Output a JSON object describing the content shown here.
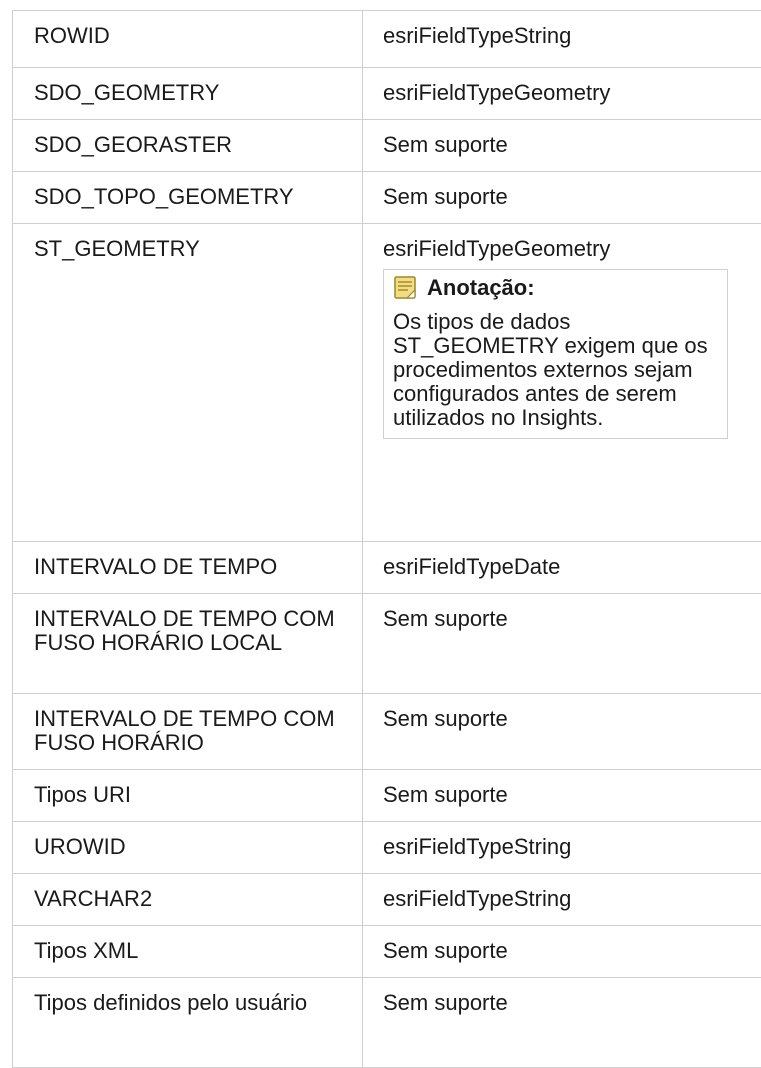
{
  "rows": [
    {
      "type": "ROWID",
      "mapping": "esriFieldTypeString"
    },
    {
      "type": "SDO_GEOMETRY",
      "mapping": "esriFieldTypeGeometry"
    },
    {
      "type": "SDO_GEORASTER",
      "mapping": "Sem suporte"
    },
    {
      "type": "SDO_TOPO_GEOMETRY",
      "mapping": "Sem suporte"
    },
    {
      "type": "ST_GEOMETRY",
      "mapping": "esriFieldTypeGeometry",
      "note": {
        "icon": "note-icon",
        "title": "Anotação:",
        "text": "Os tipos de dados ST_GEOMETRY exigem que os procedimentos externos sejam configurados antes de serem utilizados no Insights."
      }
    },
    {
      "type": "INTERVALO DE TEMPO",
      "mapping": "esriFieldTypeDate"
    },
    {
      "type": "INTERVALO DE TEMPO COM FUSO HORÁRIO LOCAL",
      "mapping": "Sem suporte"
    },
    {
      "type": "INTERVALO DE TEMPO COM FUSO HORÁRIO",
      "mapping": "Sem suporte"
    },
    {
      "type": "Tipos URI",
      "mapping": "Sem suporte"
    },
    {
      "type": "UROWID",
      "mapping": "esriFieldTypeString"
    },
    {
      "type": "VARCHAR2",
      "mapping": "esriFieldTypeString"
    },
    {
      "type": "Tipos XML",
      "mapping": "Sem suporte"
    },
    {
      "type": "Tipos definidos pelo usuário",
      "mapping": "Sem suporte"
    }
  ],
  "colors": {
    "border": "#cfcfcf",
    "text": "#1a1a1a",
    "note_icon_body": "#f4dc82",
    "note_icon_edge": "#9a8a2a"
  }
}
